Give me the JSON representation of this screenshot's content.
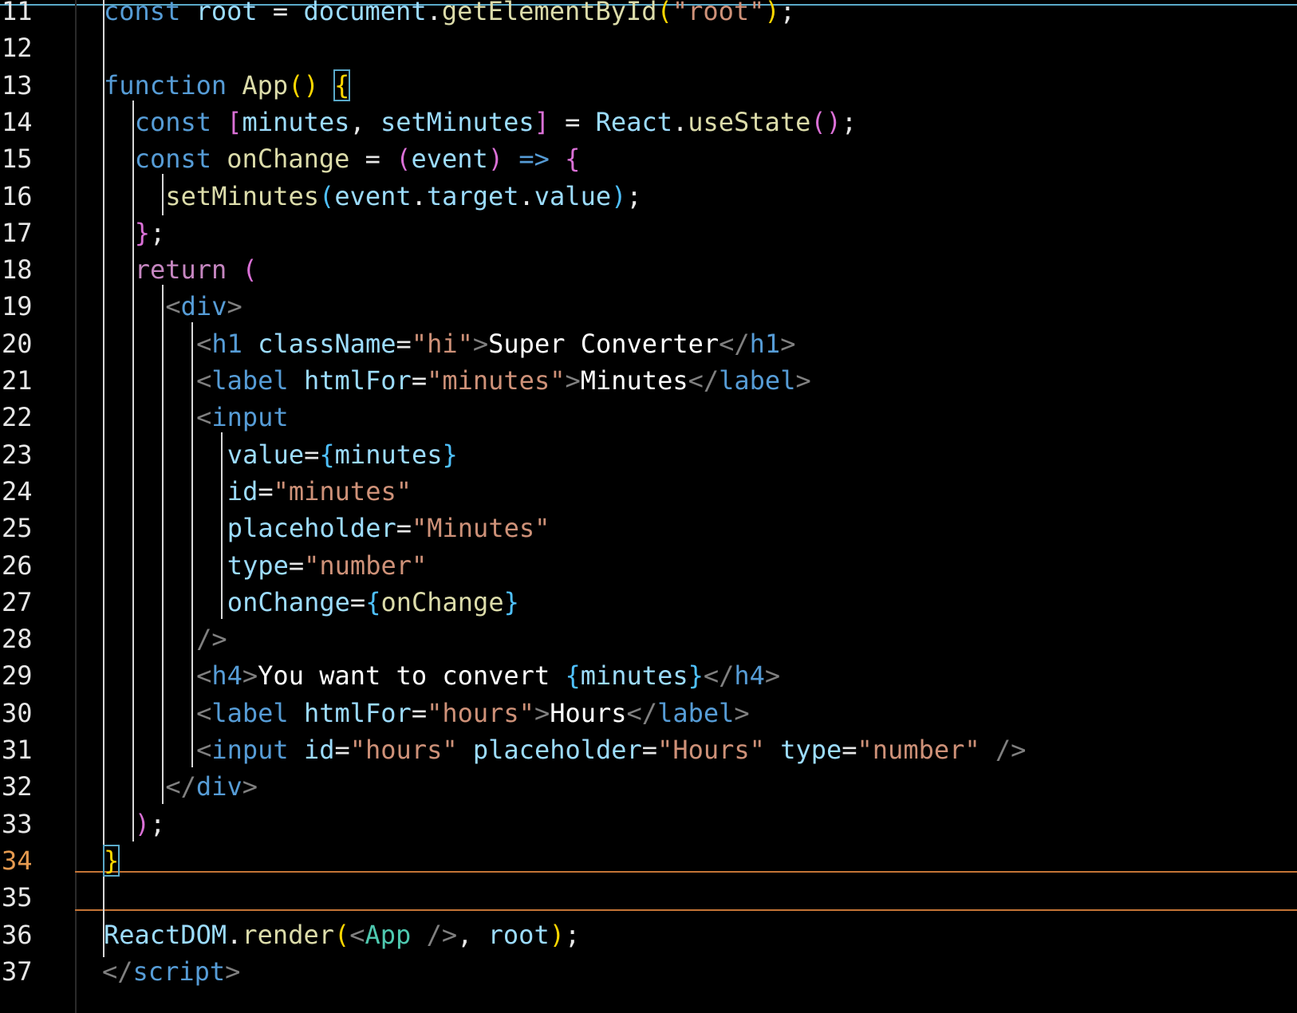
{
  "editor": {
    "current_line": "34",
    "lines": [
      {
        "n": "11",
        "y": 0,
        "tokens": [
          [
            "kw",
            "const"
          ],
          [
            "pun",
            " "
          ],
          [
            "var",
            "root"
          ],
          [
            "pun",
            " = "
          ],
          [
            "var",
            "document"
          ],
          [
            "pun",
            "."
          ],
          [
            "fn",
            "getElementById"
          ],
          [
            "br1",
            "("
          ],
          [
            "str",
            "\"root\""
          ],
          [
            "br1",
            ")"
          ],
          [
            "pun",
            ";"
          ]
        ]
      },
      {
        "n": "12",
        "tokens": []
      },
      {
        "n": "13",
        "tokens": [
          [
            "kw",
            "function"
          ],
          [
            "pun",
            " "
          ],
          [
            "fn",
            "App"
          ],
          [
            "br1",
            "()"
          ],
          [
            "pun",
            " "
          ],
          [
            "br1",
            "{"
          ]
        ]
      },
      {
        "n": "14",
        "tokens": [
          [
            "kw",
            "const"
          ],
          [
            "pun",
            " "
          ],
          [
            "br2",
            "["
          ],
          [
            "var",
            "minutes"
          ],
          [
            "pun",
            ", "
          ],
          [
            "var",
            "setMinutes"
          ],
          [
            "br2",
            "]"
          ],
          [
            "pun",
            " = "
          ],
          [
            "var",
            "React"
          ],
          [
            "pun",
            "."
          ],
          [
            "fn",
            "useState"
          ],
          [
            "br2",
            "()"
          ],
          [
            "pun",
            ";"
          ]
        ]
      },
      {
        "n": "15",
        "tokens": [
          [
            "kw",
            "const"
          ],
          [
            "pun",
            " "
          ],
          [
            "fn",
            "onChange"
          ],
          [
            "pun",
            " = "
          ],
          [
            "br2",
            "("
          ],
          [
            "var",
            "event"
          ],
          [
            "br2",
            ")"
          ],
          [
            "pun",
            " "
          ],
          [
            "kw",
            "=>"
          ],
          [
            "pun",
            " "
          ],
          [
            "br2",
            "{"
          ]
        ]
      },
      {
        "n": "16",
        "tokens": [
          [
            "fn",
            "setMinutes"
          ],
          [
            "br3",
            "("
          ],
          [
            "var",
            "event"
          ],
          [
            "pun",
            "."
          ],
          [
            "var",
            "target"
          ],
          [
            "pun",
            "."
          ],
          [
            "var",
            "value"
          ],
          [
            "br3",
            ")"
          ],
          [
            "pun",
            ";"
          ]
        ]
      },
      {
        "n": "17",
        "tokens": [
          [
            "br2",
            "}"
          ],
          [
            "pun",
            ";"
          ]
        ]
      },
      {
        "n": "18",
        "tokens": [
          [
            "kw2",
            "return"
          ],
          [
            "pun",
            " "
          ],
          [
            "br2",
            "("
          ]
        ]
      },
      {
        "n": "19",
        "tokens": [
          [
            "tagp",
            "<"
          ],
          [
            "tag",
            "div"
          ],
          [
            "tagp",
            ">"
          ]
        ]
      },
      {
        "n": "20",
        "tokens": [
          [
            "tagp",
            "<"
          ],
          [
            "tag",
            "h1"
          ],
          [
            "pun",
            " "
          ],
          [
            "attr",
            "className"
          ],
          [
            "pun",
            "="
          ],
          [
            "str",
            "\"hi\""
          ],
          [
            "tagp",
            ">"
          ],
          [
            "txt",
            "Super Converter"
          ],
          [
            "tagp",
            "</"
          ],
          [
            "tag",
            "h1"
          ],
          [
            "tagp",
            ">"
          ]
        ]
      },
      {
        "n": "21",
        "tokens": [
          [
            "tagp",
            "<"
          ],
          [
            "tag",
            "label"
          ],
          [
            "pun",
            " "
          ],
          [
            "attr",
            "htmlFor"
          ],
          [
            "pun",
            "="
          ],
          [
            "str",
            "\"minutes\""
          ],
          [
            "tagp",
            ">"
          ],
          [
            "txt",
            "Minutes"
          ],
          [
            "tagp",
            "</"
          ],
          [
            "tag",
            "label"
          ],
          [
            "tagp",
            ">"
          ]
        ]
      },
      {
        "n": "22",
        "tokens": [
          [
            "tagp",
            "<"
          ],
          [
            "tag",
            "input"
          ]
        ]
      },
      {
        "n": "23",
        "tokens": [
          [
            "attr",
            "value"
          ],
          [
            "pun",
            "="
          ],
          [
            "br3",
            "{"
          ],
          [
            "var",
            "minutes"
          ],
          [
            "br3",
            "}"
          ]
        ]
      },
      {
        "n": "24",
        "tokens": [
          [
            "attr",
            "id"
          ],
          [
            "pun",
            "="
          ],
          [
            "str",
            "\"minutes\""
          ]
        ]
      },
      {
        "n": "25",
        "tokens": [
          [
            "attr",
            "placeholder"
          ],
          [
            "pun",
            "="
          ],
          [
            "str",
            "\"Minutes\""
          ]
        ]
      },
      {
        "n": "26",
        "tokens": [
          [
            "attr",
            "type"
          ],
          [
            "pun",
            "="
          ],
          [
            "str",
            "\"number\""
          ]
        ]
      },
      {
        "n": "27",
        "tokens": [
          [
            "attr",
            "onChange"
          ],
          [
            "pun",
            "="
          ],
          [
            "br3",
            "{"
          ],
          [
            "fn",
            "onChange"
          ],
          [
            "br3",
            "}"
          ]
        ]
      },
      {
        "n": "28",
        "tokens": [
          [
            "tagp",
            "/>"
          ]
        ]
      },
      {
        "n": "29",
        "tokens": [
          [
            "tagp",
            "<"
          ],
          [
            "tag",
            "h4"
          ],
          [
            "tagp",
            ">"
          ],
          [
            "txt",
            "You want to convert "
          ],
          [
            "br3",
            "{"
          ],
          [
            "var",
            "minutes"
          ],
          [
            "br3",
            "}"
          ],
          [
            "tagp",
            "</"
          ],
          [
            "tag",
            "h4"
          ],
          [
            "tagp",
            ">"
          ]
        ]
      },
      {
        "n": "30",
        "tokens": [
          [
            "tagp",
            "<"
          ],
          [
            "tag",
            "label"
          ],
          [
            "pun",
            " "
          ],
          [
            "attr",
            "htmlFor"
          ],
          [
            "pun",
            "="
          ],
          [
            "str",
            "\"hours\""
          ],
          [
            "tagp",
            ">"
          ],
          [
            "txt",
            "Hours"
          ],
          [
            "tagp",
            "</"
          ],
          [
            "tag",
            "label"
          ],
          [
            "tagp",
            ">"
          ]
        ]
      },
      {
        "n": "31",
        "tokens": [
          [
            "tagp",
            "<"
          ],
          [
            "tag",
            "input"
          ],
          [
            "pun",
            " "
          ],
          [
            "attr",
            "id"
          ],
          [
            "pun",
            "="
          ],
          [
            "str",
            "\"hours\""
          ],
          [
            "pun",
            " "
          ],
          [
            "attr",
            "placeholder"
          ],
          [
            "pun",
            "="
          ],
          [
            "str",
            "\"Hours\""
          ],
          [
            "pun",
            " "
          ],
          [
            "attr",
            "type"
          ],
          [
            "pun",
            "="
          ],
          [
            "str",
            "\"number\""
          ],
          [
            "pun",
            " "
          ],
          [
            "tagp",
            "/>"
          ]
        ]
      },
      {
        "n": "32",
        "tokens": [
          [
            "tagp",
            "</"
          ],
          [
            "tag",
            "div"
          ],
          [
            "tagp",
            ">"
          ]
        ]
      },
      {
        "n": "33",
        "tokens": [
          [
            "br2",
            ")"
          ],
          [
            "pun",
            ";"
          ]
        ]
      },
      {
        "n": "34",
        "tokens": [
          [
            "br1",
            "}"
          ]
        ]
      },
      {
        "n": "35",
        "tokens": []
      },
      {
        "n": "36",
        "tokens": [
          [
            "var",
            "ReactDOM"
          ],
          [
            "pun",
            "."
          ],
          [
            "fn",
            "render"
          ],
          [
            "br1",
            "("
          ],
          [
            "tagp",
            "<"
          ],
          [
            "cls",
            "App"
          ],
          [
            "pun",
            " "
          ],
          [
            "tagp",
            "/>"
          ],
          [
            "pun",
            ", "
          ],
          [
            "var",
            "root"
          ],
          [
            "br1",
            ")"
          ],
          [
            "pun",
            ";"
          ]
        ]
      },
      {
        "n": "37",
        "tokens": [
          [
            "tagp",
            "</"
          ],
          [
            "tag",
            "script"
          ],
          [
            "tagp",
            ">"
          ]
        ]
      }
    ]
  }
}
